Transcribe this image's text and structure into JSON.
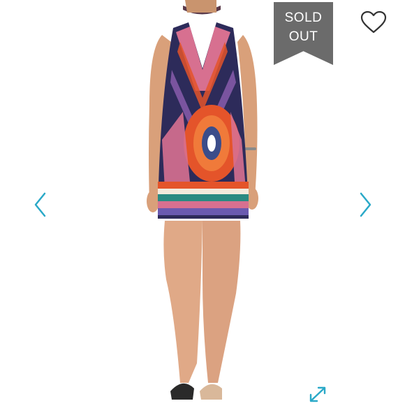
{
  "listing": {
    "status_badge": {
      "line1": "SOLD",
      "line2": "OUT"
    },
    "icons": {
      "like": "heart-outline-icon",
      "previous": "chevron-left-icon",
      "next": "chevron-right-icon",
      "expand": "expand-diagonal-icon"
    },
    "colors": {
      "badge_gray": "#6b6b6b",
      "nav_accent": "#2aa9c8",
      "dress_orange": "#e4542a",
      "dress_navy": "#2d2b5a",
      "dress_pink": "#d77090"
    }
  }
}
